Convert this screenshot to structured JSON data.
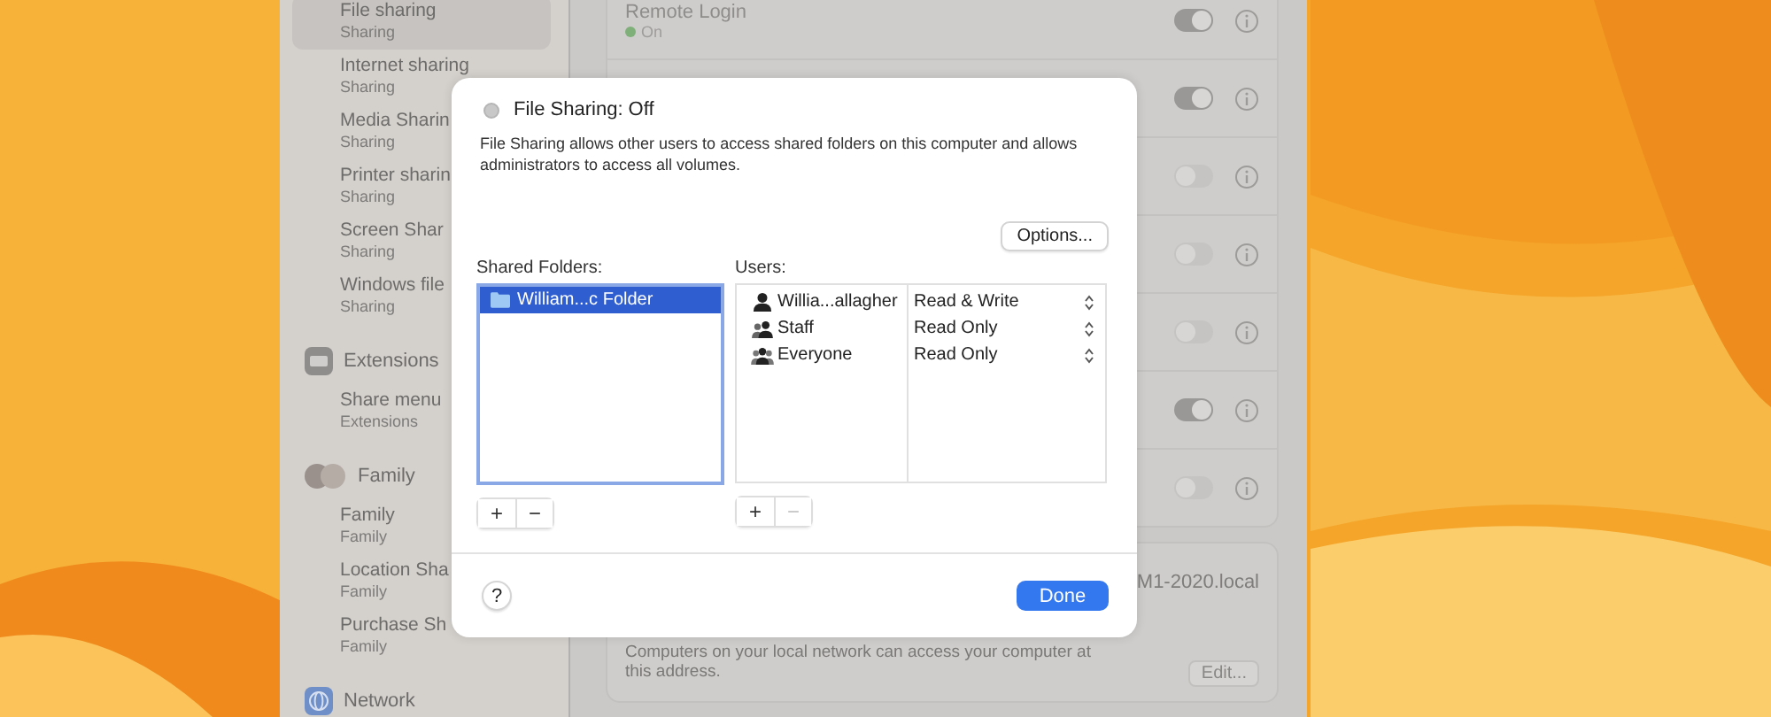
{
  "sidebar": {
    "groups": [
      {
        "items": [
          {
            "title": "File sharing",
            "subtitle": "Sharing",
            "selected": true
          },
          {
            "title": "Internet sharing",
            "subtitle": "Sharing",
            "selected": false
          },
          {
            "title": "Media Sharin",
            "subtitle": "Sharing",
            "selected": false
          },
          {
            "title": "Printer sharin",
            "subtitle": "Sharing",
            "selected": false
          },
          {
            "title": "Screen Shar",
            "subtitle": "Sharing",
            "selected": false
          },
          {
            "title": "Windows file",
            "subtitle": "Sharing",
            "selected": false
          }
        ]
      },
      {
        "heading": "Extensions",
        "items": [
          {
            "title": "Share menu",
            "subtitle": "Extensions",
            "selected": false
          }
        ]
      },
      {
        "heading": "Family",
        "items": [
          {
            "title": "Family",
            "subtitle": "Family",
            "selected": false
          },
          {
            "title": "Location Sha",
            "subtitle": "Family",
            "selected": false
          },
          {
            "title": "Purchase Sh",
            "subtitle": "Family",
            "selected": false
          }
        ]
      },
      {
        "heading": "Network"
      }
    ]
  },
  "services": [
    {
      "label": "Remote Login",
      "status": "On",
      "on": true
    },
    {
      "on": true
    },
    {
      "on": false
    },
    {
      "on": false
    },
    {
      "on": false
    },
    {
      "on": true
    },
    {
      "on": false
    }
  ],
  "host": {
    "name": "M1-2020.local",
    "description": "Computers on your local network can access your computer at this address.",
    "edit_button": "Edit..."
  },
  "dialog": {
    "title": "File Sharing: Off",
    "on": false,
    "description": "File Sharing allows other users to access shared folders on this computer and allows administrators to access all volumes.",
    "options_button": "Options...",
    "folders_label": "Shared Folders:",
    "folders": [
      {
        "name": "William...c Folder",
        "selected": true
      }
    ],
    "folder_buttons": [
      {
        "label": "+",
        "disabled": false
      },
      {
        "label": "−",
        "disabled": false
      }
    ],
    "users_label": "Users:",
    "users": [
      {
        "kind": "user",
        "name": "Willia...allagher",
        "permission": "Read & Write"
      },
      {
        "kind": "group",
        "name": "Staff",
        "permission": "Read Only"
      },
      {
        "kind": "everyone",
        "name": "Everyone",
        "permission": "Read Only"
      }
    ],
    "user_buttons": [
      {
        "label": "+",
        "disabled": false
      },
      {
        "label": "−",
        "disabled": true
      }
    ],
    "help_button": "?",
    "done_button": "Done"
  }
}
